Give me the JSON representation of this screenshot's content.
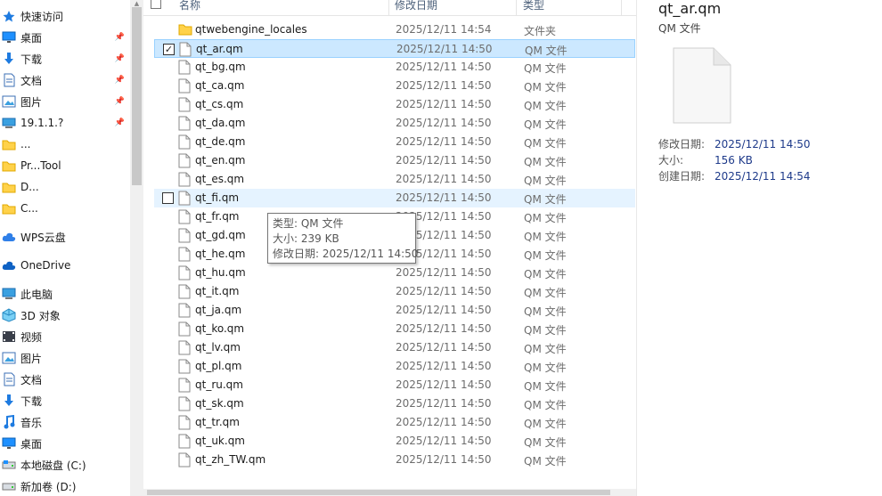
{
  "nav": {
    "quick_access": "快速访问",
    "items": [
      {
        "label": "桌面",
        "icon": "desktop-icon",
        "pinned": true
      },
      {
        "label": "下载",
        "icon": "download-icon",
        "pinned": true
      },
      {
        "label": "文档",
        "icon": "document-icon",
        "pinned": true
      },
      {
        "label": "图片",
        "icon": "picture-icon",
        "pinned": true
      },
      {
        "label": "19.1.1.?",
        "icon": "computer-icon",
        "pinned": true
      },
      {
        "label": "...",
        "icon": "folder-icon",
        "pinned": false
      },
      {
        "label": "Pr...Tool",
        "icon": "folder-icon",
        "pinned": false
      },
      {
        "label": "D...",
        "icon": "folder-icon",
        "pinned": false
      },
      {
        "label": "C...",
        "icon": "folder-icon",
        "pinned": false
      }
    ],
    "wps": "WPS云盘",
    "onedrive": "OneDrive",
    "this_pc": "此电脑",
    "pc_items": [
      {
        "label": "3D 对象",
        "icon": "3d-objects-icon"
      },
      {
        "label": "视频",
        "icon": "video-icon"
      },
      {
        "label": "图片",
        "icon": "picture-icon"
      },
      {
        "label": "文档",
        "icon": "document-icon"
      },
      {
        "label": "下载",
        "icon": "download-icon"
      },
      {
        "label": "音乐",
        "icon": "music-icon"
      },
      {
        "label": "桌面",
        "icon": "desktop-icon"
      },
      {
        "label": "本地磁盘 (C:)",
        "icon": "local-disk-icon"
      },
      {
        "label": "新加卷 (D:)",
        "icon": "drive-icon"
      }
    ]
  },
  "columns": {
    "name": "名称",
    "date": "修改日期",
    "type": "类型"
  },
  "files": [
    {
      "name": "qtwebengine_locales",
      "date": "2025/12/11 14:54",
      "type": "文件夹",
      "kind": "folder"
    },
    {
      "name": "qt_ar.qm",
      "date": "2025/12/11 14:50",
      "type": "QM 文件",
      "kind": "file"
    },
    {
      "name": "qt_bg.qm",
      "date": "2025/12/11 14:50",
      "type": "QM 文件",
      "kind": "file"
    },
    {
      "name": "qt_ca.qm",
      "date": "2025/12/11 14:50",
      "type": "QM 文件",
      "kind": "file"
    },
    {
      "name": "qt_cs.qm",
      "date": "2025/12/11 14:50",
      "type": "QM 文件",
      "kind": "file"
    },
    {
      "name": "qt_da.qm",
      "date": "2025/12/11 14:50",
      "type": "QM 文件",
      "kind": "file"
    },
    {
      "name": "qt_de.qm",
      "date": "2025/12/11 14:50",
      "type": "QM 文件",
      "kind": "file"
    },
    {
      "name": "qt_en.qm",
      "date": "2025/12/11 14:50",
      "type": "QM 文件",
      "kind": "file"
    },
    {
      "name": "qt_es.qm",
      "date": "2025/12/11 14:50",
      "type": "QM 文件",
      "kind": "file"
    },
    {
      "name": "qt_fi.qm",
      "date": "2025/12/11 14:50",
      "type": "QM 文件",
      "kind": "file"
    },
    {
      "name": "qt_fr.qm",
      "date": "2025/12/11 14:50",
      "type": "QM 文件",
      "kind": "file"
    },
    {
      "name": "qt_gd.qm",
      "date": "2025/12/11 14:50",
      "type": "QM 文件",
      "kind": "file"
    },
    {
      "name": "qt_he.qm",
      "date": "2025/12/11 14:50",
      "type": "QM 文件",
      "kind": "file"
    },
    {
      "name": "qt_hu.qm",
      "date": "2025/12/11 14:50",
      "type": "QM 文件",
      "kind": "file"
    },
    {
      "name": "qt_it.qm",
      "date": "2025/12/11 14:50",
      "type": "QM 文件",
      "kind": "file"
    },
    {
      "name": "qt_ja.qm",
      "date": "2025/12/11 14:50",
      "type": "QM 文件",
      "kind": "file"
    },
    {
      "name": "qt_ko.qm",
      "date": "2025/12/11 14:50",
      "type": "QM 文件",
      "kind": "file"
    },
    {
      "name": "qt_lv.qm",
      "date": "2025/12/11 14:50",
      "type": "QM 文件",
      "kind": "file"
    },
    {
      "name": "qt_pl.qm",
      "date": "2025/12/11 14:50",
      "type": "QM 文件",
      "kind": "file"
    },
    {
      "name": "qt_ru.qm",
      "date": "2025/12/11 14:50",
      "type": "QM 文件",
      "kind": "file"
    },
    {
      "name": "qt_sk.qm",
      "date": "2025/12/11 14:50",
      "type": "QM 文件",
      "kind": "file"
    },
    {
      "name": "qt_tr.qm",
      "date": "2025/12/11 14:50",
      "type": "QM 文件",
      "kind": "file"
    },
    {
      "name": "qt_uk.qm",
      "date": "2025/12/11 14:50",
      "type": "QM 文件",
      "kind": "file"
    },
    {
      "name": "qt_zh_TW.qm",
      "date": "2025/12/11 14:50",
      "type": "QM 文件",
      "kind": "file"
    }
  ],
  "selected_index": 1,
  "hover_index": 9,
  "tooltip": {
    "type": "类型: QM 文件",
    "size": "大小: 239 KB",
    "modified": "修改日期: 2025/12/11 14:50"
  },
  "preview": {
    "title": "qt_ar.qm",
    "type": "QM 文件",
    "modified_label": "修改日期:",
    "modified_value": "2025/12/11 14:50",
    "size_label": "大小:",
    "size_value": "156 KB",
    "created_label": "创建日期:",
    "created_value": "2025/12/11 14:54"
  },
  "colors": {
    "selection": "#cce8ff",
    "hover": "#e5f3ff",
    "folder": "#ffd24a",
    "link": "#1e3a8a"
  }
}
